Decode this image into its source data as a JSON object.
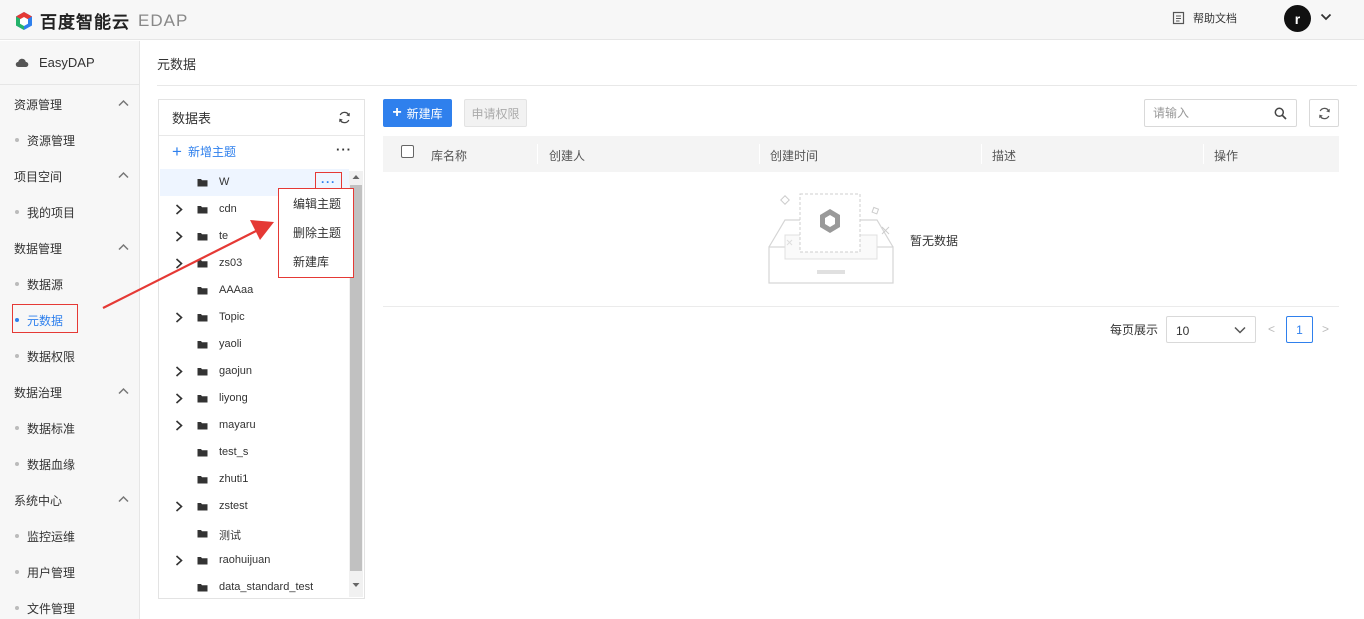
{
  "topbar": {
    "brand": "百度智能云",
    "product": "EDAP",
    "help": "帮助文档",
    "avatar_letter": "r"
  },
  "sidebar": {
    "brand": "EasyDAP",
    "groups": [
      {
        "label": "资源管理",
        "items": [
          "资源管理"
        ]
      },
      {
        "label": "项目空间",
        "items": [
          "我的项目"
        ]
      },
      {
        "label": "数据管理",
        "items": [
          "数据源",
          "元数据",
          "数据权限"
        ]
      },
      {
        "label": "数据治理",
        "items": [
          "数据标准",
          "数据血缘"
        ]
      },
      {
        "label": "系统中心",
        "items": [
          "监控运维",
          "用户管理",
          "文件管理"
        ]
      }
    ],
    "active_item": "元数据"
  },
  "main": {
    "page_title": "元数据"
  },
  "tree": {
    "title": "数据表",
    "add_topic": "新增主题",
    "more": "···",
    "rows": [
      {
        "label": "W",
        "expandable": false,
        "selected": true
      },
      {
        "label": "cdn",
        "expandable": true
      },
      {
        "label": "te",
        "expandable": true
      },
      {
        "label": "zs03",
        "expandable": true
      },
      {
        "label": "AAAaa",
        "expandable": false
      },
      {
        "label": "Topic",
        "expandable": true
      },
      {
        "label": "yaoli",
        "expandable": false
      },
      {
        "label": "gaojun",
        "expandable": true
      },
      {
        "label": "liyong",
        "expandable": true
      },
      {
        "label": "mayaru",
        "expandable": true
      },
      {
        "label": "test_s",
        "expandable": false
      },
      {
        "label": "zhuti1",
        "expandable": false
      },
      {
        "label": "zstest",
        "expandable": true
      },
      {
        "label": "测试",
        "expandable": false
      },
      {
        "label": "raohuijuan",
        "expandable": true
      },
      {
        "label": "data_standard_test",
        "expandable": false
      }
    ]
  },
  "context_menu": {
    "items": [
      "编辑主题",
      "删除主题",
      "新建库"
    ]
  },
  "toolbar": {
    "new_db": "新建库",
    "apply_permission": "申请权限",
    "search_placeholder": "请输入"
  },
  "table": {
    "columns": [
      "库名称",
      "创建人",
      "创建时间",
      "描述",
      "操作"
    ],
    "empty_text": "暂无数据"
  },
  "pagination": {
    "per_page_label": "每页展示",
    "per_page_value": "10",
    "prev": "<",
    "current_page": "1",
    "next": ">"
  },
  "colors": {
    "accent": "#2f80ed",
    "annotation": "#e53935"
  }
}
